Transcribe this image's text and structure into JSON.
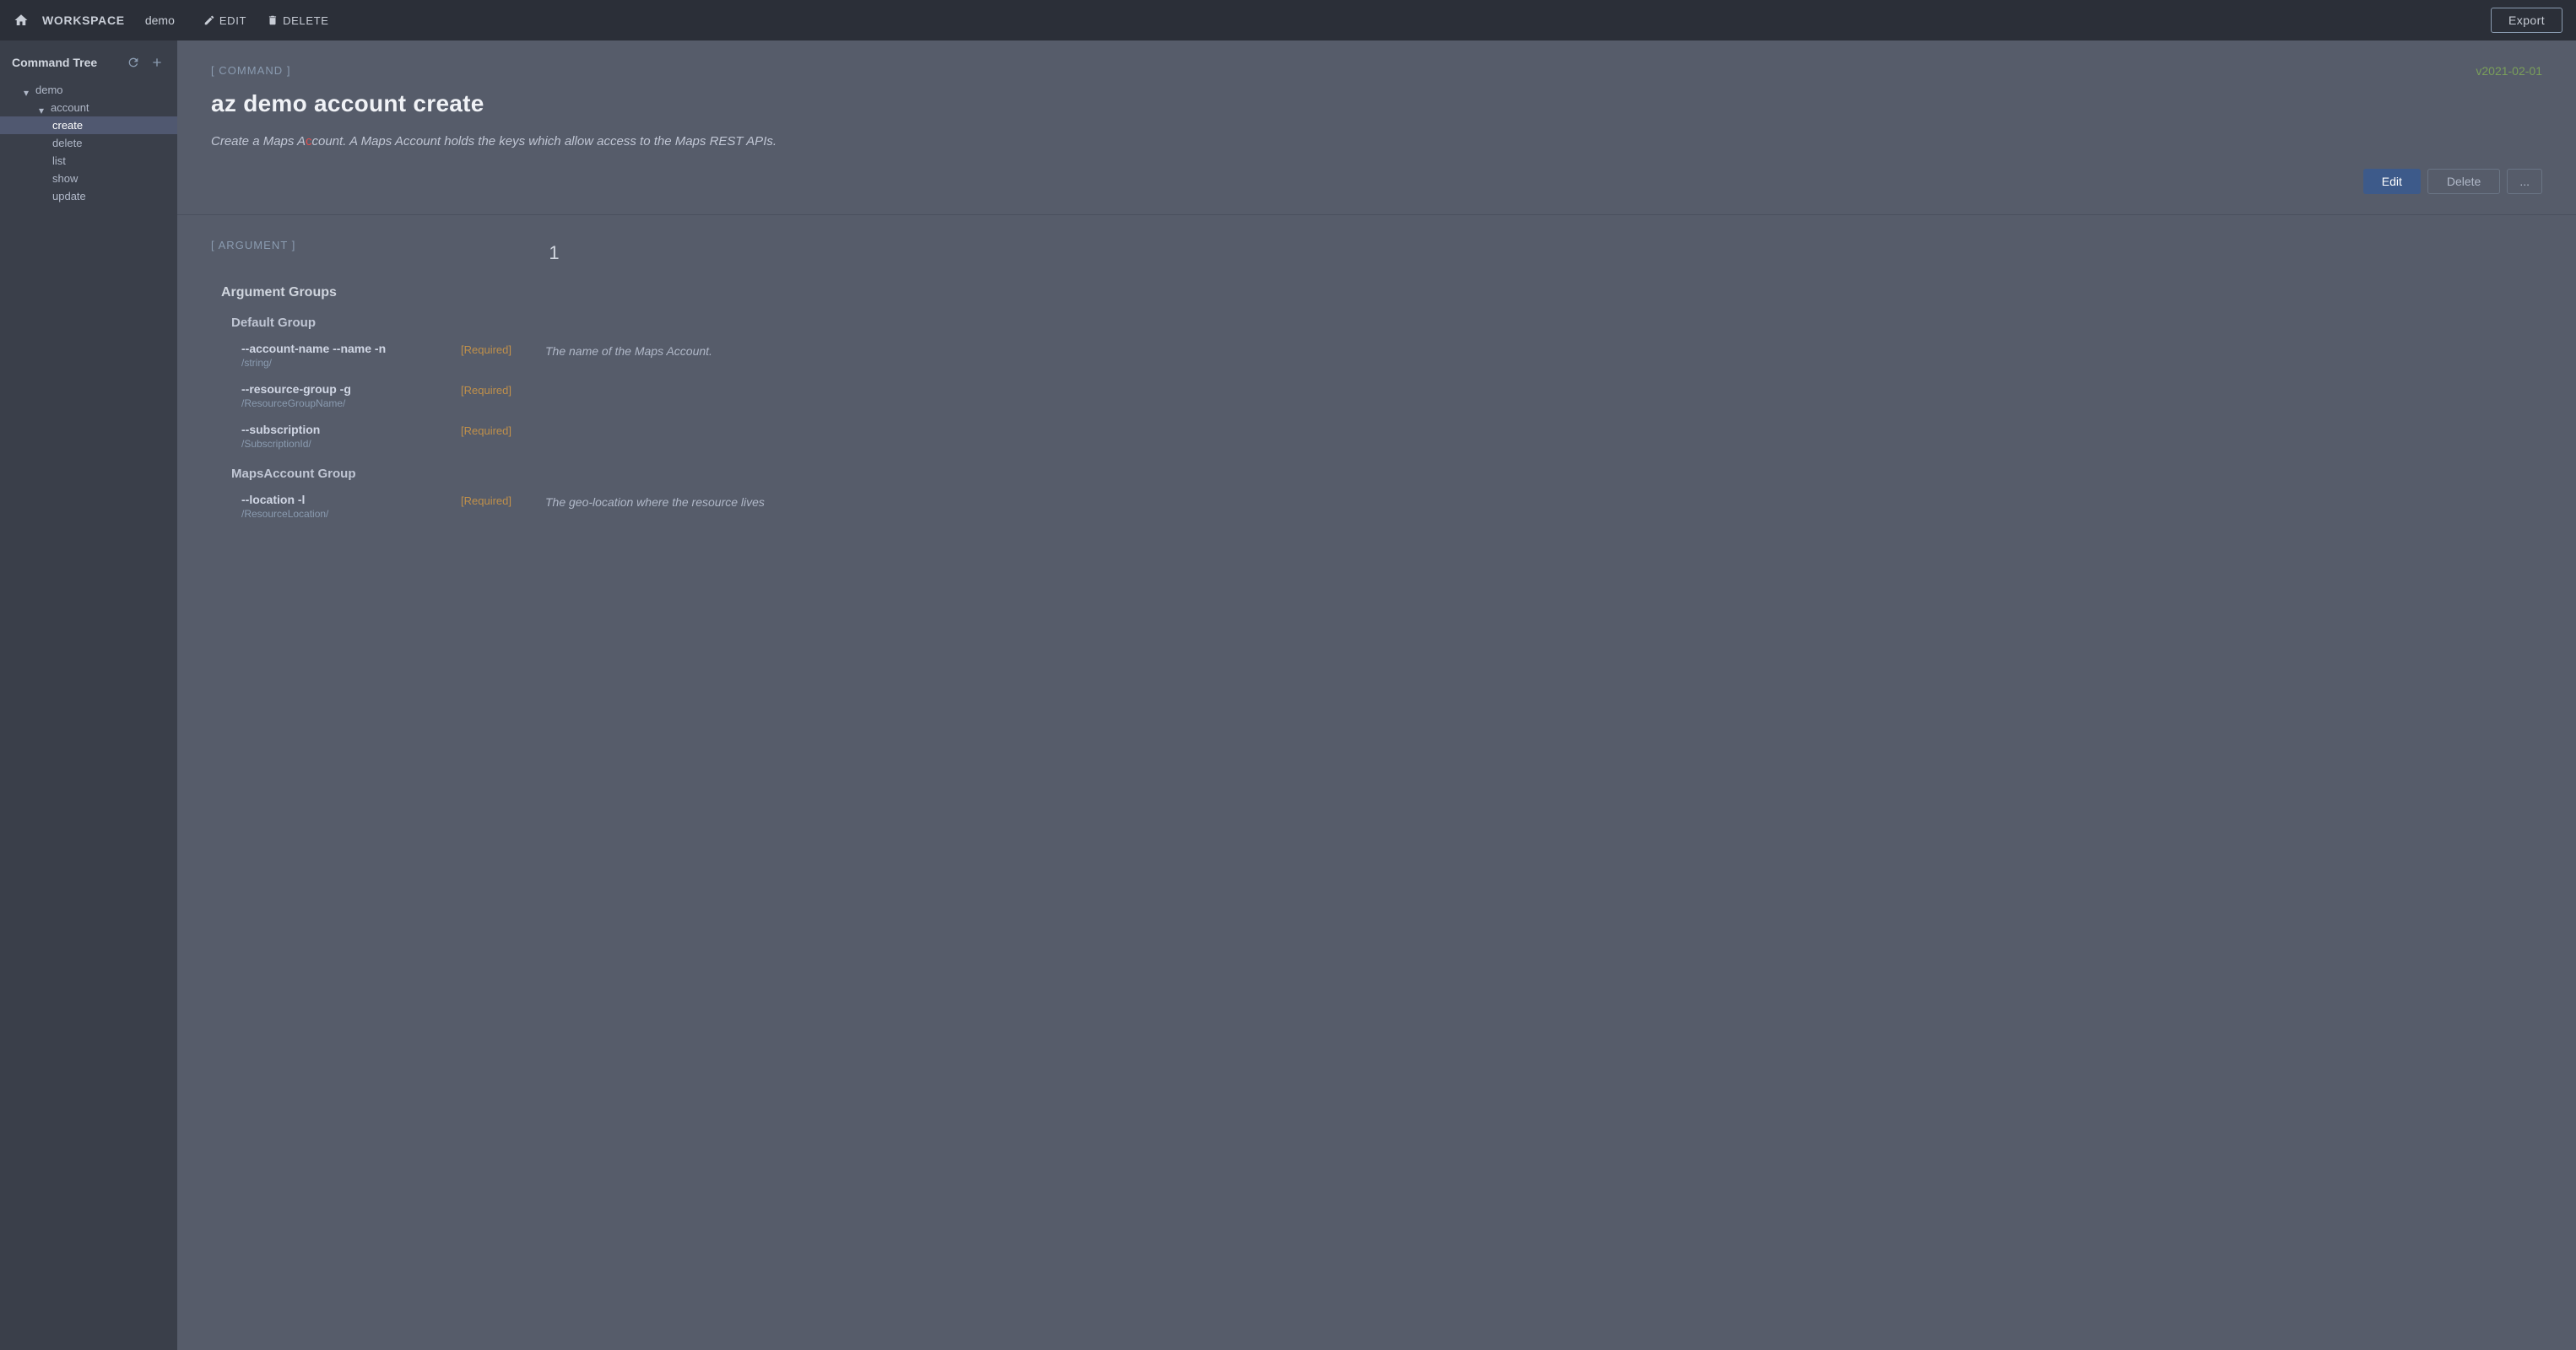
{
  "topnav": {
    "workspace_label": "WORKSPACE",
    "demo_label": "demo",
    "edit_label": "EDIT",
    "delete_label": "DELETE",
    "export_label": "Export"
  },
  "sidebar": {
    "title": "Command Tree",
    "tree": [
      {
        "id": "demo",
        "label": "demo",
        "indent": 1,
        "expanded": true,
        "chevron": "down"
      },
      {
        "id": "account",
        "label": "account",
        "indent": 2,
        "expanded": true,
        "chevron": "down"
      },
      {
        "id": "create",
        "label": "create",
        "indent": 3,
        "selected": true
      },
      {
        "id": "delete",
        "label": "delete",
        "indent": 3
      },
      {
        "id": "list",
        "label": "list",
        "indent": 3
      },
      {
        "id": "show",
        "label": "show",
        "indent": 3
      },
      {
        "id": "update",
        "label": "update",
        "indent": 3
      }
    ]
  },
  "command": {
    "section_label": "[ COMMAND ]",
    "version": "v2021-02-01",
    "title": "az demo account create",
    "description": "Create a Maps Account. A Maps Account holds the keys which allow access to the Maps REST APIs.",
    "edit_btn": "Edit",
    "delete_btn": "Delete",
    "more_btn": "..."
  },
  "argument": {
    "section_label": "[ ARGUMENT ]",
    "page_num": "1",
    "groups_label": "Argument Groups",
    "groups": [
      {
        "name": "Default Group",
        "args": [
          {
            "name": "--account-name --name -n",
            "type": "/string/",
            "required": "[Required]",
            "description": "The name of the Maps Account."
          },
          {
            "name": "--resource-group -g",
            "type": "/ResourceGroupName/",
            "required": "[Required]",
            "description": ""
          },
          {
            "name": "--subscription",
            "type": "/SubscriptionId/",
            "required": "[Required]",
            "description": ""
          }
        ]
      },
      {
        "name": "MapsAccount Group",
        "args": [
          {
            "name": "--location -l",
            "type": "/ResourceLocation/",
            "required": "[Required]",
            "description": "The geo-location where the resource lives"
          }
        ]
      }
    ]
  }
}
